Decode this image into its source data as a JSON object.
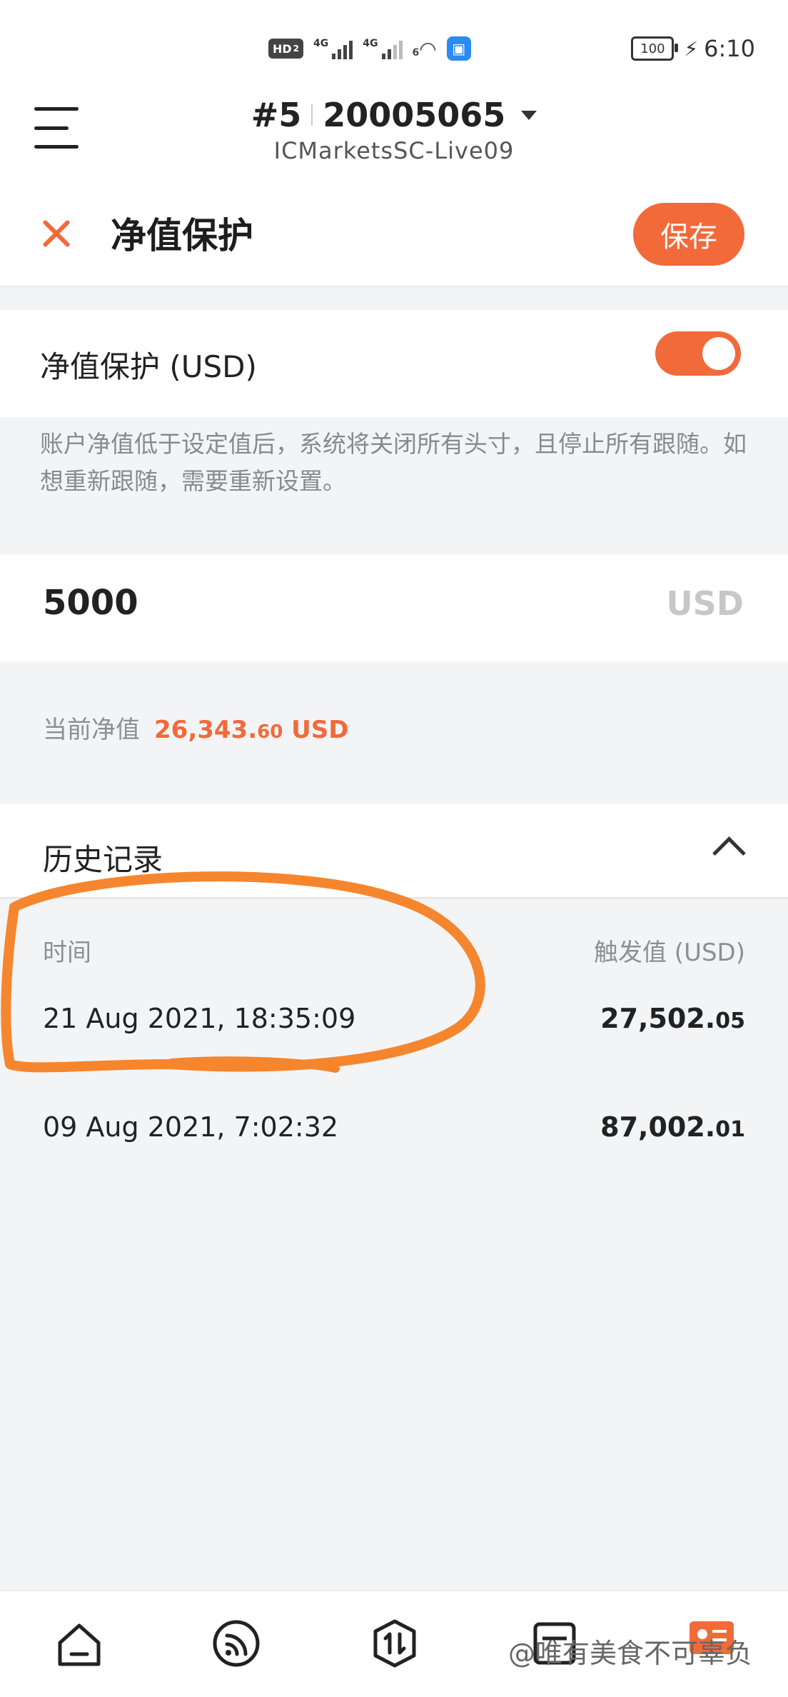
{
  "status_bar": {
    "hd_label": "HD",
    "hd_sub": "2",
    "signal1_label": "4G",
    "signal2_label": "4G",
    "wifi_label": "6",
    "battery_level": "100",
    "time": "6:10"
  },
  "header": {
    "account_index": "#5",
    "account_number": "20005065",
    "server": "ICMarketsSC-Live09"
  },
  "title_bar": {
    "title": "净值保护",
    "save_label": "保存"
  },
  "protection": {
    "toggle_label": "净值保护 (USD)",
    "toggle_on": true,
    "description": "账户净值低于设定值后，系统将关闭所有头寸，且停止所有跟随。如想重新跟随，需要重新设置。",
    "amount_value": "5000",
    "amount_unit": "USD",
    "current_label": "当前净值",
    "current_value_int": "26,343.",
    "current_value_dec": "60",
    "current_unit": "USD"
  },
  "history": {
    "title": "历史记录",
    "col_time": "时间",
    "col_value": "触发值 (USD)",
    "rows": [
      {
        "time": "21 Aug 2021, 18:35:09",
        "value_int": "27,502.",
        "value_dec": "05"
      },
      {
        "time": "09 Aug 2021, 7:02:32",
        "value_int": "87,002.",
        "value_dec": "01"
      }
    ]
  },
  "colors": {
    "accent": "#f26a3a",
    "highlight_stroke": "#f5862e"
  },
  "bottom_nav": {
    "items": [
      "home-icon",
      "signal-feed-icon",
      "trade-icon",
      "history-icon",
      "profile-icon"
    ],
    "watermark": "@唯有美食不可辜负"
  }
}
